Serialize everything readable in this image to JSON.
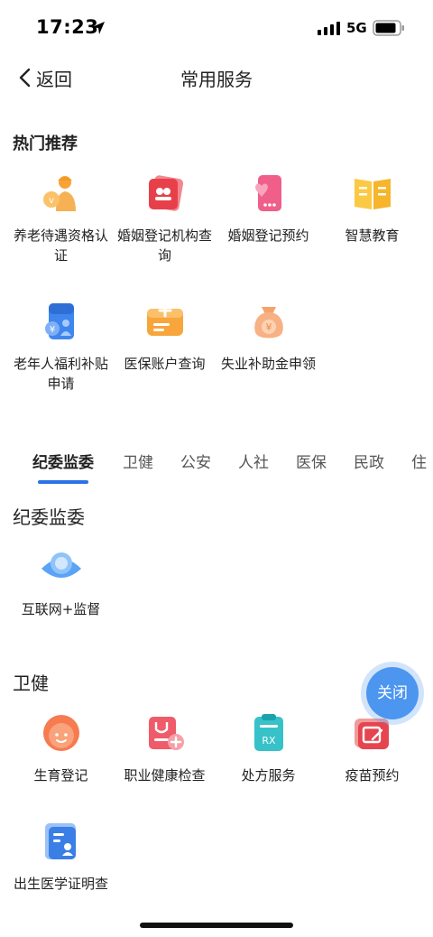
{
  "status": {
    "time": "17:23",
    "network": "5G"
  },
  "nav": {
    "back_label": "返回",
    "title": "常用服务"
  },
  "hot": {
    "title": "热门推荐",
    "items": [
      {
        "label": "养老待遇资格认证",
        "icon": "elder-worker-icon"
      },
      {
        "label": "婚姻登记机构查询",
        "icon": "marriage-card-icon"
      },
      {
        "label": "婚姻登记预约",
        "icon": "heart-phone-icon"
      },
      {
        "label": "智慧教育",
        "icon": "open-book-icon"
      },
      {
        "label": "老年人福利补贴申请",
        "icon": "elder-subsidy-icon"
      },
      {
        "label": "医保账户查询",
        "icon": "medical-wallet-icon"
      },
      {
        "label": "失业补助金申领",
        "icon": "money-bag-icon"
      }
    ]
  },
  "tabs": [
    {
      "label": "纪委监委",
      "active": true
    },
    {
      "label": "卫健",
      "active": false
    },
    {
      "label": "公安",
      "active": false
    },
    {
      "label": "人社",
      "active": false
    },
    {
      "label": "医保",
      "active": false
    },
    {
      "label": "民政",
      "active": false
    },
    {
      "label": "住",
      "active": false
    }
  ],
  "sections": {
    "jiwei": {
      "title": "纪委监委",
      "items": [
        {
          "label": "互联网+监督",
          "icon": "eye-icon"
        }
      ]
    },
    "weijian": {
      "title": "卫健",
      "items": [
        {
          "label": "生育登记",
          "icon": "baby-face-icon"
        },
        {
          "label": "职业健康检查",
          "icon": "health-check-icon"
        },
        {
          "label": "处方服务",
          "icon": "prescription-rx-icon"
        },
        {
          "label": "疫苗预约",
          "icon": "vaccine-calendar-icon"
        },
        {
          "label": "出生医学证明查",
          "icon": "birth-certificate-icon"
        }
      ]
    }
  },
  "fab": {
    "label": "关闭"
  }
}
